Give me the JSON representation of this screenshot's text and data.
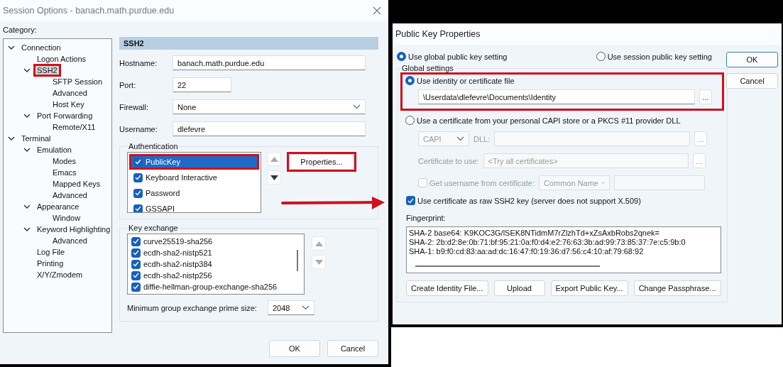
{
  "session_window": {
    "title": "Session Options - banach.math.purdue.edu",
    "category_label": "Category:",
    "tree": [
      {
        "label": "Connection",
        "expanded": true,
        "selected": false,
        "highlighted": false,
        "children": [
          {
            "label": "Logon Actions",
            "selected": false,
            "highlighted": false
          },
          {
            "label": "SSH2",
            "expanded": true,
            "selected": true,
            "highlighted": true,
            "children": [
              {
                "label": "SFTP Session",
                "selected": false,
                "highlighted": false
              },
              {
                "label": "Advanced",
                "selected": false,
                "highlighted": false
              },
              {
                "label": "Host Key",
                "selected": false,
                "highlighted": false
              }
            ]
          },
          {
            "label": "Port Forwarding",
            "expanded": true,
            "selected": false,
            "highlighted": false,
            "children": [
              {
                "label": "Remote/X11",
                "selected": false,
                "highlighted": false
              }
            ]
          }
        ]
      },
      {
        "label": "Terminal",
        "expanded": true,
        "selected": false,
        "highlighted": false,
        "children": [
          {
            "label": "Emulation",
            "expanded": true,
            "selected": false,
            "highlighted": false,
            "children": [
              {
                "label": "Modes",
                "selected": false,
                "highlighted": false
              },
              {
                "label": "Emacs",
                "selected": false,
                "highlighted": false
              },
              {
                "label": "Mapped Keys",
                "selected": false,
                "highlighted": false
              },
              {
                "label": "Advanced",
                "selected": false,
                "highlighted": false
              }
            ]
          },
          {
            "label": "Appearance",
            "expanded": true,
            "selected": false,
            "highlighted": false,
            "children": [
              {
                "label": "Window",
                "selected": false,
                "highlighted": false
              }
            ]
          },
          {
            "label": "Keyword Highlighting",
            "expanded": true,
            "selected": false,
            "highlighted": false,
            "children": [
              {
                "label": "Advanced",
                "selected": false,
                "highlighted": false
              }
            ]
          },
          {
            "label": "Log File",
            "selected": false,
            "highlighted": false
          },
          {
            "label": "Printing",
            "selected": false,
            "highlighted": false
          },
          {
            "label": "X/Y/Zmodem",
            "selected": false,
            "highlighted": false
          }
        ]
      }
    ],
    "section_title": "SSH2",
    "fields": [
      {
        "label": "Hostname:",
        "value": "banach.math.purdue.edu",
        "kind": "text"
      },
      {
        "label": "Port:",
        "value": "22",
        "kind": "number"
      },
      {
        "label": "Firewall:",
        "value": "None",
        "kind": "select"
      },
      {
        "label": "Username:",
        "value": "dlefevre",
        "kind": "text"
      }
    ],
    "authentication": {
      "title": "Authentication",
      "methods": [
        {
          "label": "PublicKey",
          "checked": true,
          "selected": true,
          "highlighted": true
        },
        {
          "label": "Keyboard Interactive",
          "checked": true,
          "selected": false,
          "highlighted": false
        },
        {
          "label": "Password",
          "checked": true,
          "selected": false,
          "highlighted": false
        },
        {
          "label": "GSSAPI",
          "checked": true,
          "selected": false,
          "highlighted": false
        }
      ],
      "properties_button": {
        "label": "Properties...",
        "highlighted": true
      }
    },
    "key_exchange": {
      "title": "Key exchange",
      "items": [
        {
          "label": "curve25519-sha256",
          "checked": true
        },
        {
          "label": "ecdh-sha2-nistp521",
          "checked": true
        },
        {
          "label": "ecdh-sha2-nistp384",
          "checked": true
        },
        {
          "label": "ecdh-sha2-nistp256",
          "checked": true
        },
        {
          "label": "diffie-hellman-group-exchange-sha256",
          "checked": true
        }
      ],
      "prime_size_label": "Minimum group exchange prime size:",
      "prime_size": "2048"
    },
    "buttons": [
      "OK",
      "Cancel"
    ]
  },
  "public_key_window": {
    "title": "Public Key Properties",
    "scope_options": [
      {
        "label": "Use global public key setting",
        "selected": true
      },
      {
        "label": "Use session public key setting",
        "selected": false
      }
    ],
    "global_settings": {
      "title": "Global settings",
      "sources": [
        {
          "label": "Use identity or certificate file",
          "selected": true,
          "highlighted": true
        },
        {
          "label": "Use a certificate from your personal CAPI store or a PKCS #11 provider DLL",
          "selected": false,
          "highlighted": false
        }
      ],
      "identity_path": "\\Userdata\\dlefevre\\Documents\\Identity",
      "browse_label": "...",
      "capi": {
        "disabled": true,
        "store": "CAPI",
        "dll_label": "DLL:",
        "dll_browse": "...",
        "certificate_label": "Certificate to use:",
        "certificate": "<Try all certificates>",
        "certificate_browse": "...",
        "username_option": {
          "label": "Get username from certificate:",
          "checked": false
        },
        "username_source": "Common Name"
      },
      "raw_key_option": {
        "label": "Use certificate as raw SSH2 key (server does not support X.509)",
        "checked": true
      },
      "fingerprint_label": "Fingerprint:",
      "fingerprint_lines": [
        "SHA-2 base64: K9KOC3G/lSEK8NTidmM7rZlzhTd+xZsAxbRobs2qnek=",
        "SHA-2: 2b:d2:8e:0b:71:bf:95:21:0a:f0:d4:e2:76:63:3b:ad:99:73:85:37:7e:c5:9b:0",
        "SHA-1: b9:f0:cd:83:aa:ad:dc:16:47:f0:19:36:d7:56:c4:10:af:79:68:92"
      ],
      "action_buttons": [
        "Create Identity File...",
        "Upload",
        "Export Public Key...",
        "Change Passphrase..."
      ]
    },
    "buttons": [
      "OK",
      "Cancel"
    ]
  }
}
